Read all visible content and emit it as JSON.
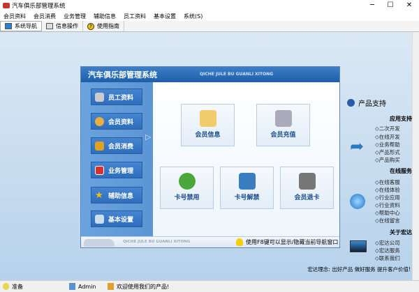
{
  "window": {
    "title": "汽车俱乐部管理系统",
    "min": "─",
    "max": "☐",
    "close": "✕"
  },
  "menu": [
    "会员资料",
    "会员消费",
    "业务管理",
    "辅助信息",
    "员工资料",
    "基本设置",
    "系统(S)"
  ],
  "toolbar": [
    "系统导航",
    "信息操作",
    "使用指南"
  ],
  "panel": {
    "title": "汽车俱乐部管理系统",
    "subtitle": "QICHE JULE BU GUANLI XITONG",
    "nav": [
      "员工资料",
      "会员资料",
      "会员消费",
      "业务管理",
      "辅助信息",
      "基本设置"
    ],
    "tiles": [
      "会员信息",
      "会员充值",
      "卡号禁用",
      "卡号解禁",
      "会员退卡"
    ],
    "footer_text": "QICHE JULE BU GUANLI XITONG",
    "hint": "使用F8键可以显示/隐藏当前导航窗口"
  },
  "support": {
    "title": "产品支持",
    "sections": [
      {
        "title": "应用支持",
        "items": [
          "二次开发",
          "在线开发",
          "业务帮助",
          "产品形式",
          "产品购买"
        ]
      },
      {
        "title": "在线服务",
        "items": [
          "在线客服",
          "在线体验",
          "行业应用",
          "行业资料",
          "帮助中心",
          "在线留言"
        ]
      },
      {
        "title": "关于宏达",
        "items": [
          "宏达公司",
          "宏达服务",
          "联系我们"
        ]
      }
    ],
    "slogan": "宏达理念: 出好产品 做好服务 提升客户价值!"
  },
  "status": [
    "准备",
    "Admin",
    "欢迎使用我们的产品!"
  ]
}
